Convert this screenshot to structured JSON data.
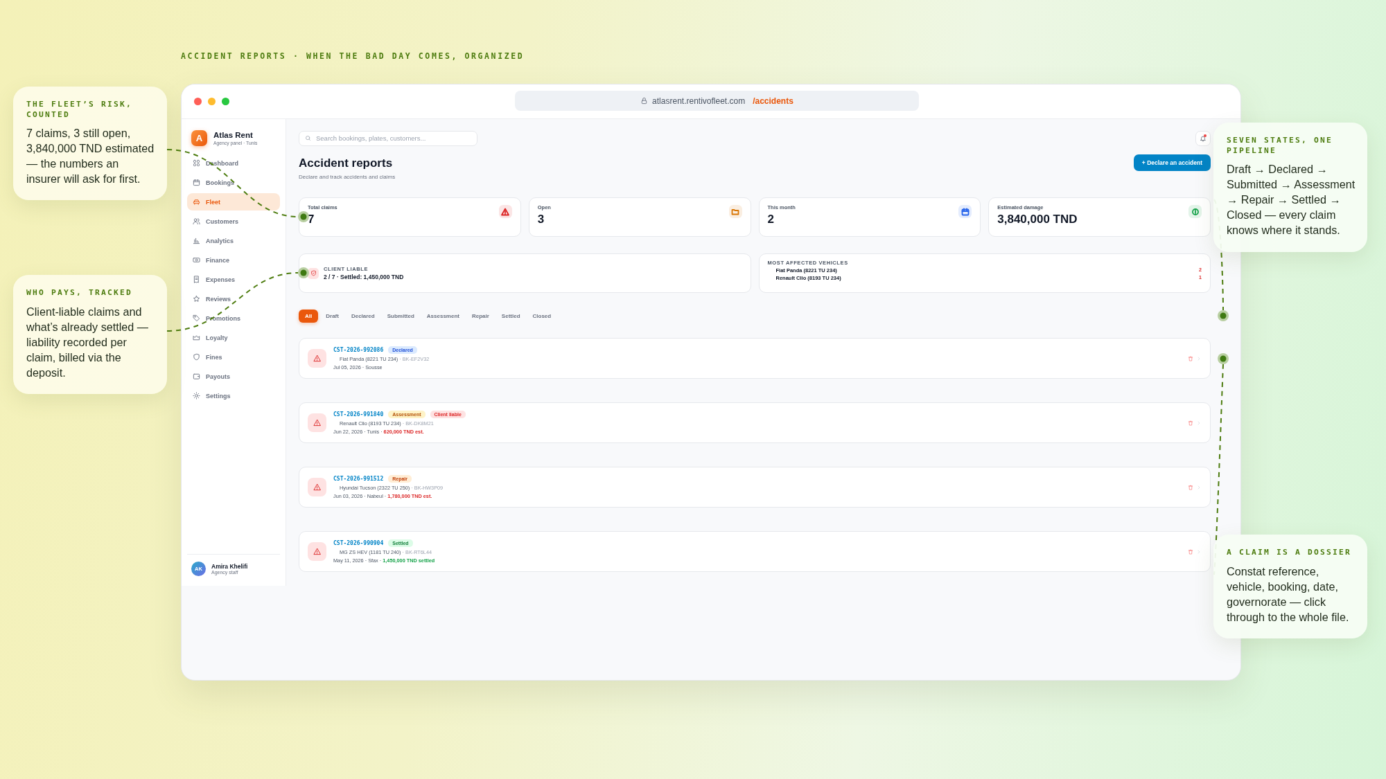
{
  "caption": "ACCIDENT REPORTS · WHEN THE BAD DAY COMES, ORGANIZED",
  "left_callouts": [
    {
      "title": "THE FLEET’S RISK, COUNTED",
      "body": "7 claims, 3 still open, 3,840,000 TND estimated — the numbers an insurer will ask for first."
    },
    {
      "title": "WHO PAYS, TRACKED",
      "body": "Client-liable claims and what’s already settled — liability recorded per claim, billed via the deposit."
    }
  ],
  "right_callouts": [
    {
      "title": "SEVEN STATES, ONE PIPELINE",
      "body": "Draft → Declared → Submitted → Assessment → Repair → Settled → Closed — every claim knows where it stands."
    },
    {
      "title": "A CLAIM IS A DOSSIER",
      "body": "Constat reference, vehicle, booking, date, governorate — click through to the whole file."
    }
  ],
  "browser": {
    "url_host": "atlasrent.rentivofleet.com",
    "url_path": "/accidents"
  },
  "sidebar": {
    "brand": {
      "initial": "A",
      "name": "Atlas Rent",
      "subtitle": "Agency panel · Tunis"
    },
    "items": [
      {
        "label": "Dashboard",
        "selected": false
      },
      {
        "label": "Bookings",
        "selected": false
      },
      {
        "label": "Fleet",
        "selected": true
      },
      {
        "label": "Customers",
        "selected": false
      },
      {
        "label": "Analytics",
        "selected": false
      },
      {
        "label": "Finance",
        "selected": false
      },
      {
        "label": "Expenses",
        "selected": false
      },
      {
        "label": "Reviews",
        "selected": false
      },
      {
        "label": "Promotions",
        "selected": false
      },
      {
        "label": "Loyalty",
        "selected": false
      },
      {
        "label": "Fines",
        "selected": false
      },
      {
        "label": "Payouts",
        "selected": false
      },
      {
        "label": "Settings",
        "selected": false
      }
    ],
    "user": {
      "initials": "AK",
      "name": "Amira Khelifi",
      "role": "Agency staff"
    }
  },
  "header": {
    "search": {
      "placeholder": "Search bookings, plates, customers..."
    }
  },
  "page": {
    "title": "Accident reports",
    "subtitle": "Declare and track accidents and claims",
    "primary_button": "+ Declare an accident"
  },
  "stats": [
    {
      "label": "Total claims",
      "value": "7",
      "color": "#dc2626"
    },
    {
      "label": "Open",
      "value": "3",
      "color": "#d97706"
    },
    {
      "label": "This month",
      "value": "2",
      "color": "#2563eb"
    },
    {
      "label": "Estimated damage",
      "value": "3,840,000 TND",
      "color": "#16a34a"
    }
  ],
  "client_liable": {
    "label": "CLIENT LIABLE",
    "value": "2 / 7 · Settled: 1,450,000 TND"
  },
  "most_affected": {
    "label": "MOST AFFECTED VEHICLES",
    "vehicles": [
      {
        "name": "Fiat Panda (8221 TU 234)",
        "count": "2"
      },
      {
        "name": "Renault Clio (8193 TU 234)",
        "count": "1"
      }
    ]
  },
  "filters": [
    {
      "label": "All",
      "selected": true
    },
    {
      "label": "Draft",
      "selected": false
    },
    {
      "label": "Declared",
      "selected": false
    },
    {
      "label": "Submitted",
      "selected": false
    },
    {
      "label": "Assessment",
      "selected": false
    },
    {
      "label": "Repair",
      "selected": false
    },
    {
      "label": "Settled",
      "selected": false
    },
    {
      "label": "Closed",
      "selected": false
    }
  ],
  "claims": [
    {
      "reference": "CST-2026-992086",
      "badges": [
        {
          "label": "Declared",
          "kind": "declared"
        }
      ],
      "vehicle": "Fiat Panda (8221 TU 234)",
      "booking": "· BK-EF2V32",
      "date_place": "Jul 05, 2026 · Sousse"
    },
    {
      "reference": "CST-2026-991840",
      "badges": [
        {
          "label": "Assessment",
          "kind": "assessment"
        },
        {
          "label": "Client liable",
          "kind": "liable"
        }
      ],
      "vehicle": "Renault Clio (8193 TU 234)",
      "booking": "· BK-DK8M21",
      "date_place": "Jun 22, 2026 · Tunis ·",
      "amount": {
        "text": "620,000 TND est.",
        "kind": "estimate"
      }
    },
    {
      "reference": "CST-2026-991512",
      "badges": [
        {
          "label": "Repair",
          "kind": "repair"
        }
      ],
      "vehicle": "Hyundai Tucson (2322 TU 250)",
      "booking": "· BK-HW3P09",
      "date_place": "Jun 03, 2026 · Nabeul ·",
      "amount": {
        "text": "1,780,000 TND est.",
        "kind": "estimate"
      }
    },
    {
      "reference": "CST-2026-990904",
      "badges": [
        {
          "label": "Settled",
          "kind": "settled"
        }
      ],
      "vehicle": "MG ZS HEV (1181 TU 240)",
      "booking": "· BK-RT6L44",
      "date_place": "May 11, 2026 · Sfax ·",
      "amount": {
        "text": "1,450,000 TND settled",
        "kind": "settled"
      }
    }
  ]
}
